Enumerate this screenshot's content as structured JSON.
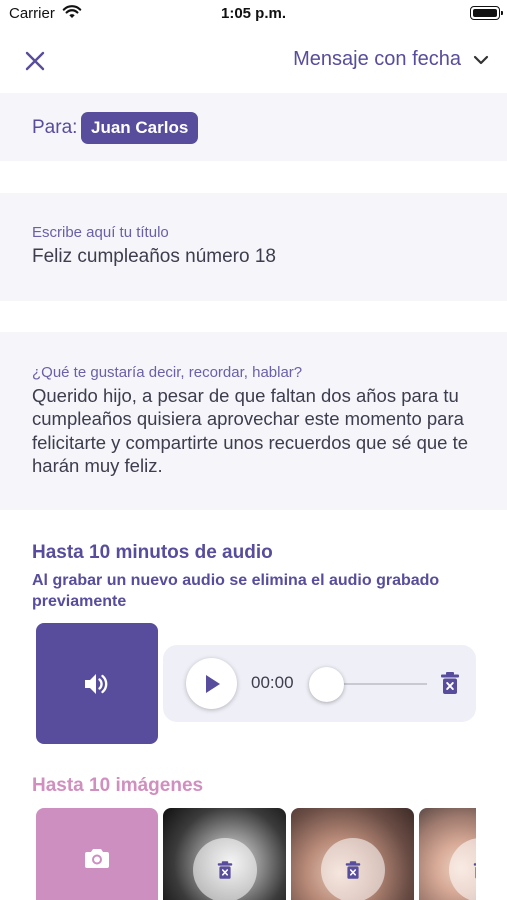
{
  "status_bar": {
    "carrier": "Carrier",
    "time": "1:05 p.m."
  },
  "nav": {
    "message_type": "Mensaje con fecha"
  },
  "recipient": {
    "label": "Para:",
    "name": "Juan Carlos"
  },
  "title_field": {
    "label": "Escribe aquí tu título",
    "value": "Feliz cumpleaños número 18"
  },
  "body_field": {
    "label": "¿Qué te gustaría decir, recordar, hablar?",
    "value": "Querido hijo, a pesar de que faltan dos años para tu cumpleaños quisiera aprovechar este momento para felicitarte y compartirte unos recuerdos que sé que te harán muy feliz."
  },
  "audio": {
    "title": "Hasta 10 minutos de audio",
    "warning": "Al grabar un nuevo audio se elimina el audio grabado previamente",
    "time": "00:00",
    "progress": 0
  },
  "images": {
    "title": "Hasta 10 imágenes"
  },
  "colors": {
    "primary": "#574d9c",
    "pink": "#cc8fc0",
    "card_bg": "#f5f5fa"
  }
}
